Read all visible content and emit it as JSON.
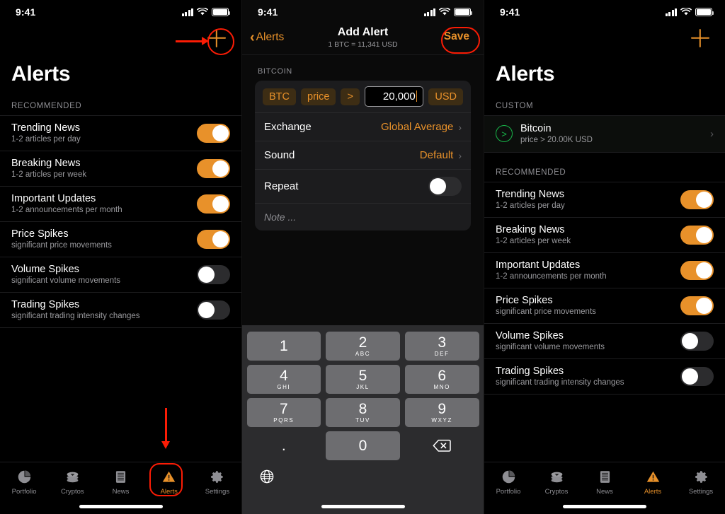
{
  "statusbar": {
    "time": "9:41",
    "cellular_icon": "cellular-bars-icon",
    "wifi_icon": "wifi-icon",
    "battery_icon": "battery-icon"
  },
  "accent": "#e8912a",
  "annotation_color": "#fb1c05",
  "panel1": {
    "title": "Alerts",
    "add_icon": "plus-icon",
    "section_label": "RECOMMENDED",
    "items": [
      {
        "title": "Trending News",
        "subtitle": "1-2 articles per day",
        "on": true
      },
      {
        "title": "Breaking News",
        "subtitle": "1-2 articles per week",
        "on": true
      },
      {
        "title": "Important Updates",
        "subtitle": "1-2 announcements per month",
        "on": true
      },
      {
        "title": "Price Spikes",
        "subtitle": "significant price movements",
        "on": true
      },
      {
        "title": "Volume Spikes",
        "subtitle": "significant volume movements",
        "on": false
      },
      {
        "title": "Trading Spikes",
        "subtitle": "significant trading intensity changes",
        "on": false
      }
    ]
  },
  "panel2": {
    "back_label": "Alerts",
    "title": "Add Alert",
    "subtitle": "1 BTC = 11,341 USD",
    "save_label": "Save",
    "section_label": "BITCOIN",
    "condition": {
      "asset_chip": "BTC",
      "metric_chip": "price",
      "operator_chip": ">",
      "value": "20,000",
      "currency_chip": "USD"
    },
    "rows": [
      {
        "label": "Exchange",
        "value": "Global Average"
      },
      {
        "label": "Sound",
        "value": "Default"
      }
    ],
    "repeat": {
      "label": "Repeat",
      "on": false
    },
    "note_placeholder": "Note ...",
    "keypad": {
      "keys": [
        {
          "num": "1",
          "sub": ""
        },
        {
          "num": "2",
          "sub": "ABC"
        },
        {
          "num": "3",
          "sub": "DEF"
        },
        {
          "num": "4",
          "sub": "GHI"
        },
        {
          "num": "5",
          "sub": "JKL"
        },
        {
          "num": "6",
          "sub": "MNO"
        },
        {
          "num": "7",
          "sub": "PQRS"
        },
        {
          "num": "8",
          "sub": "TUV"
        },
        {
          "num": "9",
          "sub": "WXYZ"
        },
        {
          "num": ".",
          "sub": ""
        },
        {
          "num": "0",
          "sub": ""
        }
      ],
      "backspace_icon": "backspace-icon",
      "globe_icon": "globe-icon"
    }
  },
  "panel3": {
    "title": "Alerts",
    "add_icon": "plus-icon",
    "custom_label": "CUSTOM",
    "custom_item": {
      "icon": "greater-than-circle-icon",
      "title": "Bitcoin",
      "subtitle": "price > 20.00K USD",
      "chevron": "chevron-right-icon"
    },
    "section_label": "RECOMMENDED",
    "items": [
      {
        "title": "Trending News",
        "subtitle": "1-2 articles per day",
        "on": true
      },
      {
        "title": "Breaking News",
        "subtitle": "1-2 articles per week",
        "on": true
      },
      {
        "title": "Important Updates",
        "subtitle": "1-2 announcements per month",
        "on": true
      },
      {
        "title": "Price Spikes",
        "subtitle": "significant price movements",
        "on": true
      },
      {
        "title": "Volume Spikes",
        "subtitle": "significant volume movements",
        "on": false
      },
      {
        "title": "Trading Spikes",
        "subtitle": "significant trading intensity changes",
        "on": false
      }
    ]
  },
  "tabbar": {
    "tabs": [
      {
        "label": "Portfolio",
        "icon": "pie-chart-icon",
        "active": false
      },
      {
        "label": "Cryptos",
        "icon": "coins-stack-icon",
        "active": false
      },
      {
        "label": "News",
        "icon": "document-lines-icon",
        "active": false
      },
      {
        "label": "Alerts",
        "icon": "warning-triangle-icon",
        "active": true
      },
      {
        "label": "Settings",
        "icon": "gear-icon",
        "active": false
      }
    ]
  }
}
